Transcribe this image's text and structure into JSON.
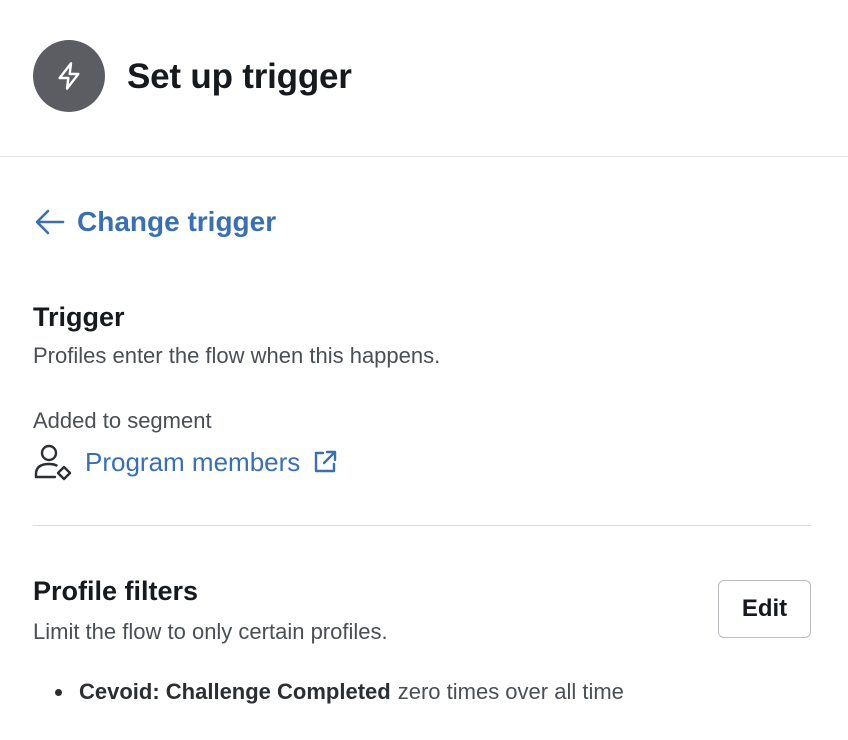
{
  "header": {
    "title": "Set up trigger",
    "icon": "lightning-bolt-icon"
  },
  "navigation": {
    "back_label": "Change trigger",
    "back_icon": "arrow-left-icon"
  },
  "trigger_section": {
    "title": "Trigger",
    "description": "Profiles enter the flow when this happens.",
    "event_label": "Added to segment",
    "segment_icon": "user-segment-icon",
    "segment_name": "Program members",
    "segment_link_icon": "external-link-icon"
  },
  "filters_section": {
    "title": "Profile filters",
    "description": "Limit the flow to only certain profiles.",
    "edit_label": "Edit",
    "filters": [
      {
        "metric": "Cevoid: Challenge Completed",
        "condition": "zero times over all time"
      }
    ]
  },
  "colors": {
    "link": "#3a6fb0",
    "badge_bg": "#5b5d62",
    "divider": "#d9dce0"
  }
}
